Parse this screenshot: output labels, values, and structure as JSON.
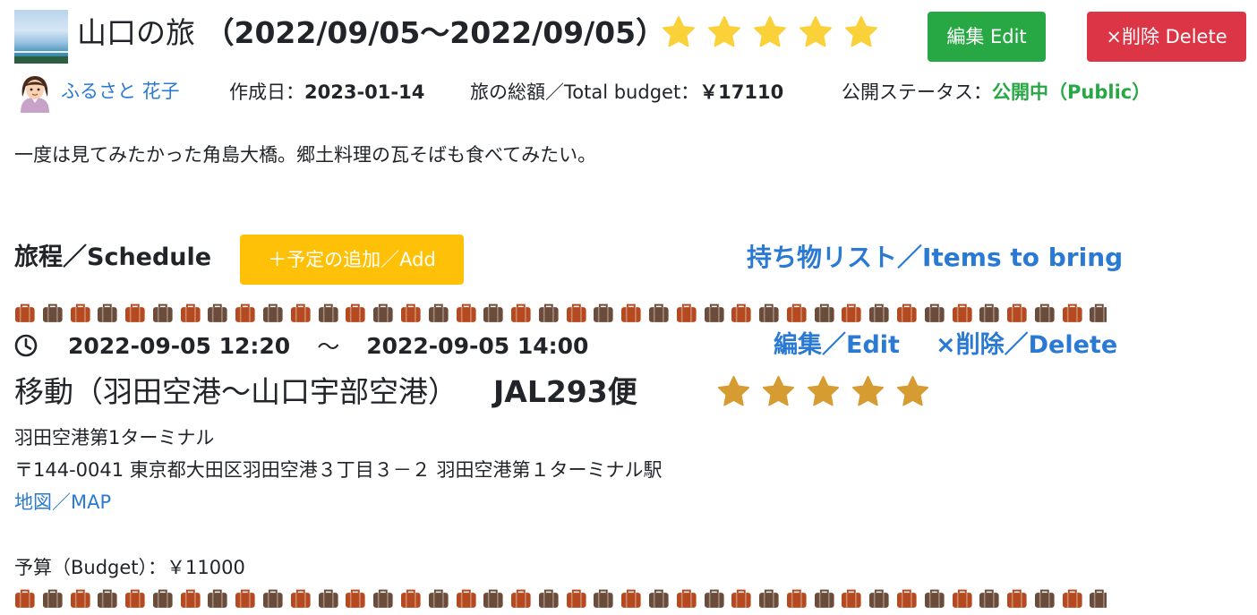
{
  "trip": {
    "title_prefix": "山口の旅",
    "date_range": "（2022/09/05～2022/09/05）",
    "rating": 5,
    "edit_label": "編集 Edit",
    "delete_label": "×削除 Delete",
    "author": "ふるさと 花子",
    "created_label": "作成日：",
    "created_value": "2023-01-14",
    "budget_label": "旅の総額／Total budget：",
    "budget_value": "￥17110",
    "status_label": "公開ステータス：",
    "status_value": "公開中（Public）",
    "description": "一度は見てみたかった角島大橋。郷土料理の瓦そばも食べてみたい。"
  },
  "schedule": {
    "heading": "旅程／Schedule",
    "add_label": "＋予定の追加／Add",
    "items_link": "持ち物リスト／Items to bring"
  },
  "event": {
    "start": "2022-09-05 12:20",
    "separator": "～",
    "end": "2022-09-05 14:00",
    "edit_label": "編集／Edit",
    "delete_label": "×削除／Delete",
    "title": "移動（羽田空港～山口宇部空港）",
    "flight": "JAL293便",
    "rating": 5,
    "place": "羽田空港第1ターミナル",
    "address": "〒144-0041 東京都大田区羽田空港３丁目３－２ 羽田空港第１ターミナル駅",
    "map_label": "地図／MAP",
    "budget_text": "予算（Budget）：￥11000"
  },
  "colors": {
    "star_yellow": "#fbd139",
    "star_gold": "#d69c32",
    "edit_green": "#28a745",
    "delete_red": "#dc3545",
    "add_yellow": "#ffc107",
    "link_blue": "#2a7ad3",
    "bag_dark": "#6b4c3a",
    "bag_rust": "#b54a20"
  },
  "icons": {
    "thumbnail": "trip-photo-thumbnail",
    "avatar": "user-avatar-icon",
    "clock": "clock-icon",
    "bag": "suitcase-icon",
    "star": "star-icon"
  }
}
